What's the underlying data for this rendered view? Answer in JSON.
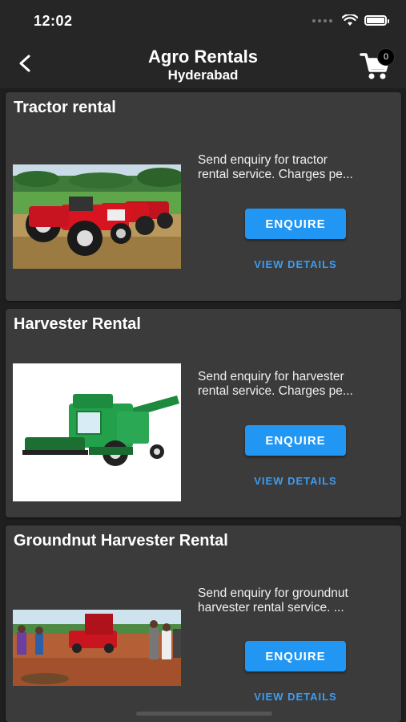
{
  "status": {
    "time": "12:02"
  },
  "header": {
    "title": "Agro Rentals",
    "subtitle": "Hyderabad",
    "cart_count": "0"
  },
  "cards": [
    {
      "title": "Tractor rental",
      "desc_line1": "Send enquiry for tractor",
      "desc_line2": "rental service. Charges pe...",
      "enquire_label": "ENQUIRE",
      "details_label": "VIEW DETAILS"
    },
    {
      "title": "Harvester Rental",
      "desc_line1": "Send enquiry for harvester",
      "desc_line2": "rental service. Charges pe...",
      "enquire_label": "ENQUIRE",
      "details_label": "VIEW DETAILS"
    },
    {
      "title": "Groundnut Harvester Rental",
      "desc_line1": "Send enquiry for groundnut",
      "desc_line2": "harvester rental service. ...",
      "enquire_label": "ENQUIRE",
      "details_label": "VIEW DETAILS"
    }
  ],
  "colors": {
    "accent": "#2196f3",
    "link": "#3d9cf0",
    "card": "#3b3b3b",
    "background": "#1f1f1f"
  },
  "icons": {
    "back": "back-arrow-icon",
    "cart": "cart-icon",
    "wifi": "wifi-icon",
    "battery": "battery-icon"
  }
}
